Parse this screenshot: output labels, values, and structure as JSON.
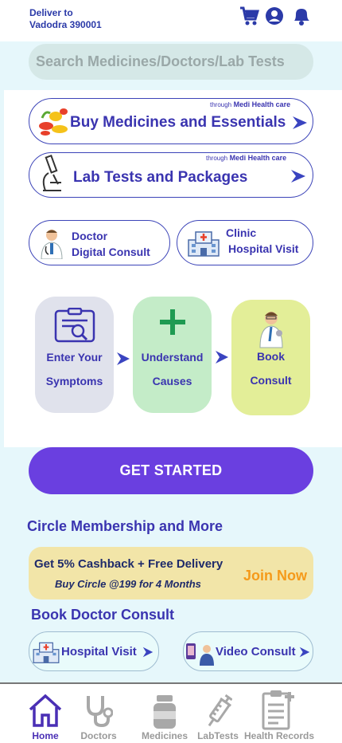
{
  "header": {
    "deliver_line1": "Deliver to",
    "deliver_line2": "Vadodra 390001",
    "icons": [
      "cart-icon",
      "account-icon",
      "bell-icon"
    ]
  },
  "search": {
    "placeholder": "Search Medicines/Doctors/Lab Tests"
  },
  "services": {
    "medicines": {
      "label": "Buy Medicines and Essentials",
      "through": "through",
      "partner": "Medi Health care"
    },
    "lab": {
      "label": "Lab Tests and Packages",
      "through": "through",
      "partner": "Medi Health care"
    },
    "doctor": {
      "line1": "Doctor",
      "line2": "Digital Consult"
    },
    "clinic": {
      "line1": "Clinic",
      "line2": "Hospital Visit"
    }
  },
  "steps": [
    {
      "line1": "Enter Your",
      "line2": "Symptoms"
    },
    {
      "line1": "Understand",
      "line2": "Causes"
    },
    {
      "line1": "Book",
      "line2": "Consult"
    }
  ],
  "cta": {
    "label": "GET STARTED"
  },
  "membership": {
    "title": "Circle Membership and More",
    "promo_line1": "Get 5% Cashback + Free Delivery",
    "promo_line2": "Buy Circle @199 for 4 Months",
    "join_label": "Join Now"
  },
  "book_consult": {
    "title": "Book Doctor Consult",
    "hospital_label": "Hospital Visit",
    "video_label": "Video Consult"
  },
  "nav": [
    {
      "label": "Home",
      "active": true
    },
    {
      "label": "Doctors",
      "active": false
    },
    {
      "label": "Medicines",
      "active": false
    },
    {
      "label": "LabTests",
      "active": false
    },
    {
      "label": "Health Records",
      "active": false
    }
  ],
  "colors": {
    "brand_blue": "#3a34b0",
    "cta_purple": "#6a3fe0",
    "promo_bg": "#f2e5a8",
    "join_orange": "#f59a1a",
    "page_bg": "#e6f7fb"
  }
}
